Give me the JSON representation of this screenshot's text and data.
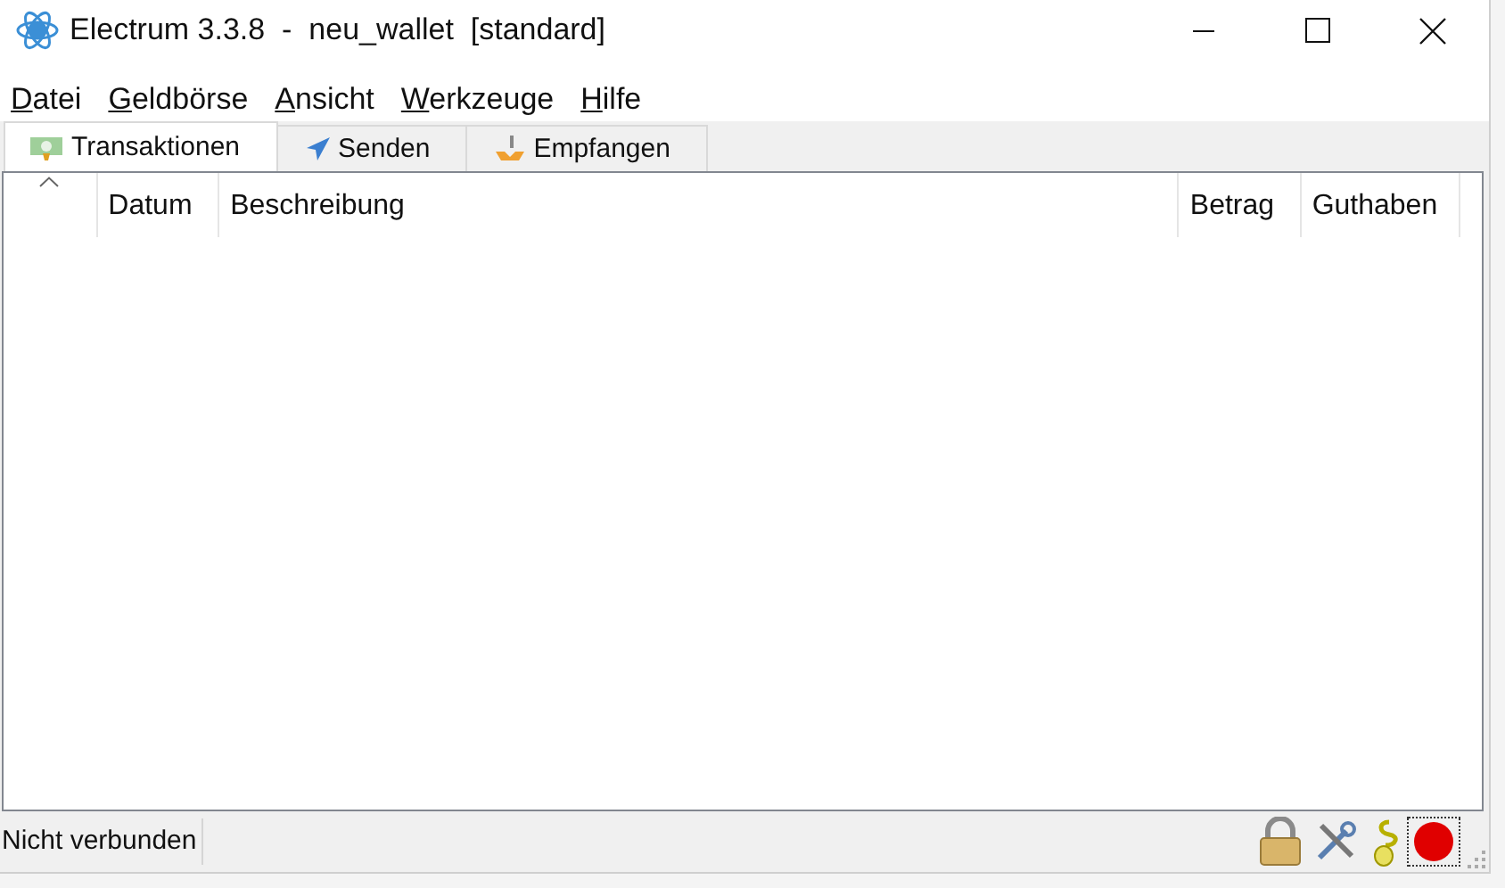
{
  "window": {
    "title": "Electrum 3.3.8  -  neu_wallet  [standard]"
  },
  "menu": [
    "Datei",
    "Geldbörse",
    "Ansicht",
    "Werkzeuge",
    "Hilfe"
  ],
  "tabs": [
    {
      "label": "Transaktionen",
      "selected": true
    },
    {
      "label": "Senden",
      "selected": false
    },
    {
      "label": "Empfangen",
      "selected": false
    }
  ],
  "table": {
    "columns": [
      "Datum",
      "Beschreibung",
      "Betrag",
      "Guthaben"
    ]
  },
  "status_bar": {
    "text": "Nicht verbunden",
    "connected": false
  }
}
